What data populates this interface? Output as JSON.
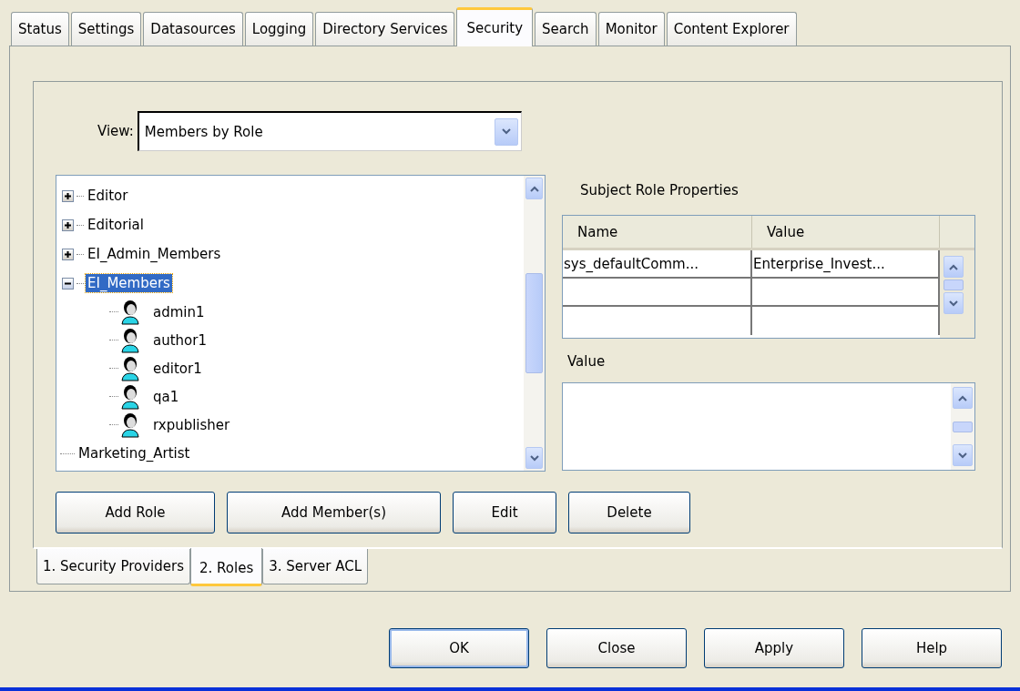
{
  "tabs": [
    {
      "label": "Status",
      "selected": false
    },
    {
      "label": "Settings",
      "selected": false
    },
    {
      "label": "Datasources",
      "selected": false
    },
    {
      "label": "Logging",
      "selected": false
    },
    {
      "label": "Directory Services",
      "selected": false
    },
    {
      "label": "Security",
      "selected": true
    },
    {
      "label": "Search",
      "selected": false
    },
    {
      "label": "Monitor",
      "selected": false
    },
    {
      "label": "Content Explorer",
      "selected": false
    }
  ],
  "view": {
    "label": "View:",
    "value": "Members by Role"
  },
  "tree": [
    {
      "label": "Editor",
      "kind": "role",
      "expanded": false,
      "selected": false
    },
    {
      "label": "Editorial",
      "kind": "role",
      "expanded": false,
      "selected": false
    },
    {
      "label": "EI_Admin_Members",
      "kind": "role",
      "expanded": false,
      "selected": false
    },
    {
      "label": "EI_Members",
      "kind": "role",
      "expanded": true,
      "selected": true,
      "children": [
        {
          "label": "admin1",
          "kind": "user",
          "selected": false
        },
        {
          "label": "author1",
          "kind": "user",
          "selected": false
        },
        {
          "label": "editor1",
          "kind": "user",
          "selected": false
        },
        {
          "label": "qa1",
          "kind": "user",
          "selected": false
        },
        {
          "label": "rxpublisher",
          "kind": "user",
          "selected": false
        }
      ]
    },
    {
      "label": "Marketing_Artist",
      "kind": "leaf",
      "selected": false
    }
  ],
  "properties": {
    "title": "Subject Role Properties",
    "columns": [
      "Name",
      "Value"
    ],
    "rows": [
      {
        "name": "sys_defaultComm...",
        "value": "Enterprise_Invest..."
      },
      {},
      {}
    ],
    "value_label": "Value"
  },
  "actions": [
    "Add Role",
    "Add Member(s)",
    "Edit",
    "Delete"
  ],
  "subtabs": [
    {
      "label": "1. Security Providers",
      "selected": false
    },
    {
      "label": "2. Roles",
      "selected": true
    },
    {
      "label": "3. Server ACL",
      "selected": false
    }
  ],
  "buttons": [
    {
      "label": "OK",
      "default": true
    },
    {
      "label": "Close",
      "default": false
    },
    {
      "label": "Apply",
      "default": false
    },
    {
      "label": "Help",
      "default": false
    }
  ]
}
